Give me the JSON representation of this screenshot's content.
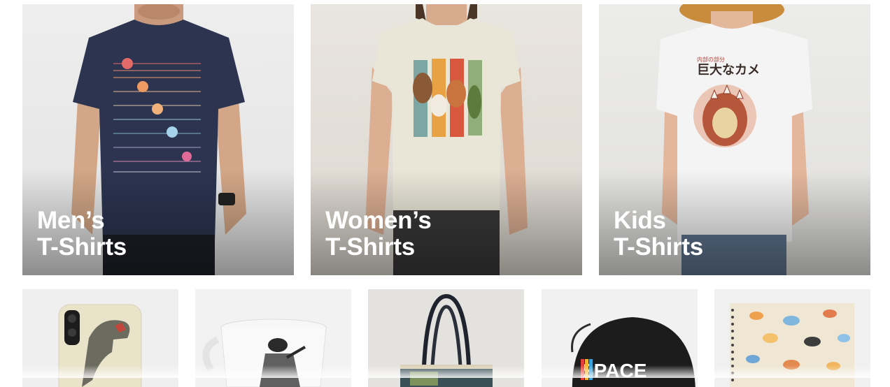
{
  "categories_large": [
    {
      "line1": "Men’s",
      "line2": "T-Shirts"
    },
    {
      "line1": "Women’s",
      "line2": "T-Shirts"
    },
    {
      "line1": "Kids",
      "line2": "T-Shirts"
    }
  ],
  "kids_design": {
    "title": "巨大なカメ",
    "subtitle": "内部の部分"
  },
  "hat_design": {
    "text": "SPACE"
  },
  "colors": {
    "label_text": "#ffffff",
    "page_background": "#ffffff"
  }
}
